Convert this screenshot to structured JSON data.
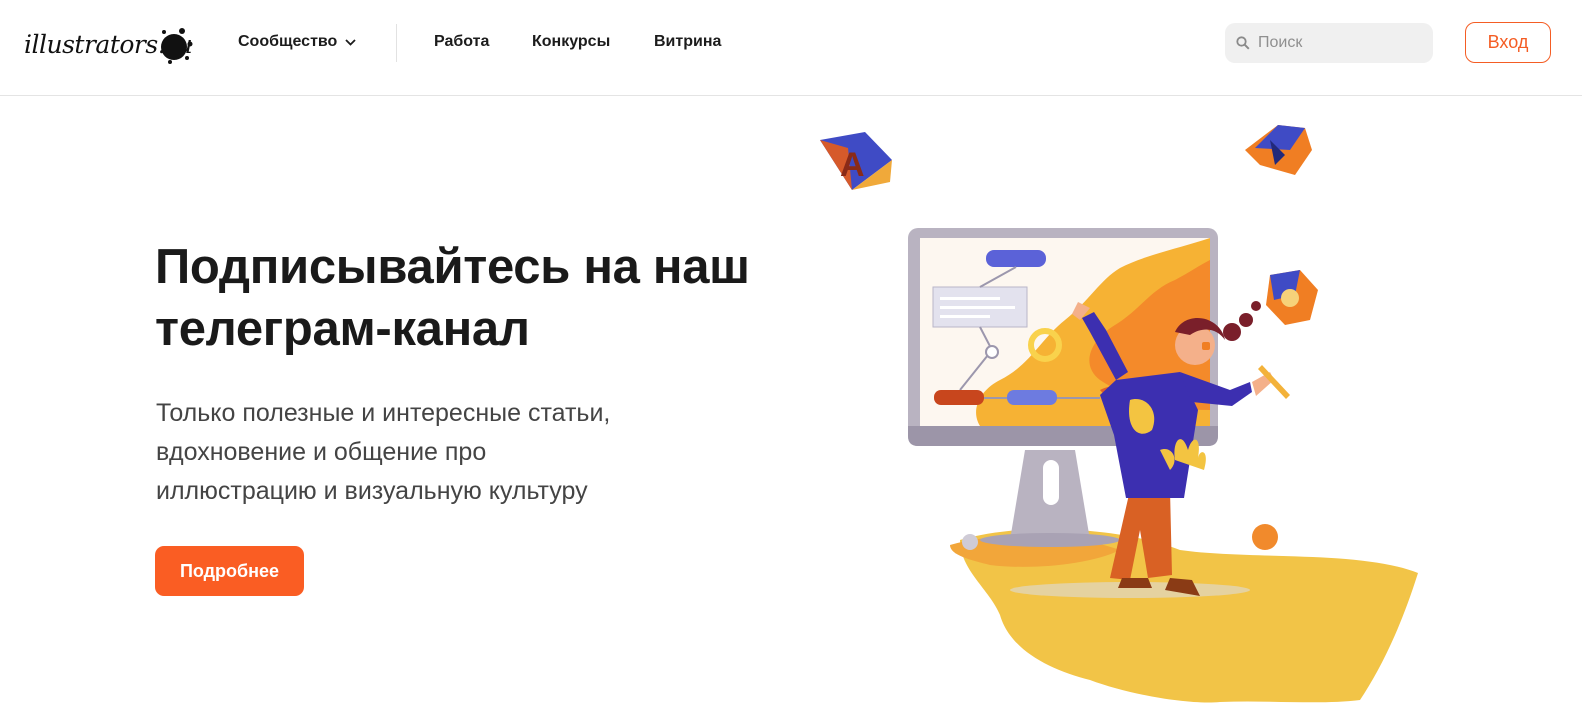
{
  "header": {
    "logo_text": "illustrators.ru",
    "nav": {
      "community": "Сообщество",
      "links": [
        "Работа",
        "Конкурсы",
        "Витрина"
      ]
    },
    "search": {
      "placeholder": "Поиск",
      "value": ""
    },
    "login_label": "Вход"
  },
  "hero": {
    "title_line1": "Подписывайтесь на наш",
    "title_line2": "телеграм-канал",
    "subtitle_line1": "Только полезные и интересные статьи,",
    "subtitle_line2": "вдохновение и общение про",
    "subtitle_line3": "иллюстрацию и визуальную культуру",
    "cta_label": "Подробнее",
    "illustration_cube_letter": "A"
  },
  "colors": {
    "accent": "#f45d24",
    "button_bg": "#fa5d23",
    "text_dark": "#1c1c1c",
    "text_muted": "#444444",
    "search_bg": "#f0f0f0"
  }
}
